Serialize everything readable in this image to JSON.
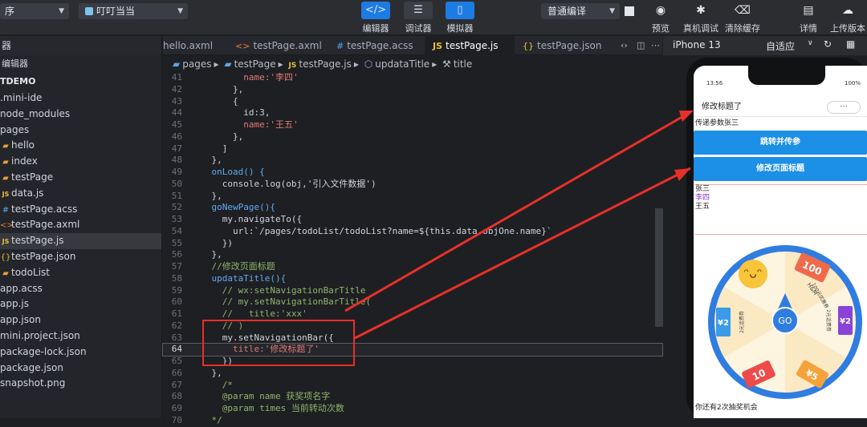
{
  "toolbar": {
    "mode_select": "序",
    "project_select": "叮叮当当",
    "buttons": [
      {
        "label": "编辑器",
        "icon": "code-icon",
        "active": true
      },
      {
        "label": "调试器",
        "icon": "sliders-icon",
        "active": false
      },
      {
        "label": "模拟器",
        "icon": "phone-icon",
        "active": false
      }
    ],
    "compile_select": "普通编译",
    "right_buttons": [
      {
        "label": "预览",
        "icon": "eye-icon"
      },
      {
        "label": "真机调试",
        "icon": "bug-icon"
      },
      {
        "label": "清除缓存",
        "icon": "broom-icon"
      },
      {
        "label": "详情",
        "icon": "document-icon"
      },
      {
        "label": "上传版本",
        "icon": "upload-icon"
      }
    ]
  },
  "sidebar": {
    "header": "器",
    "subheader": "编辑器",
    "project": "TDEMO",
    "items": [
      {
        "label": ".mini-ide",
        "icon": ""
      },
      {
        "label": "node_modules",
        "icon": ""
      },
      {
        "label": "pages",
        "icon": ""
      },
      {
        "label": "hello",
        "icon": "folder-icon"
      },
      {
        "label": "index",
        "icon": "folder-icon"
      },
      {
        "label": "testPage",
        "icon": "folder-icon"
      },
      {
        "label": "data.js",
        "icon": "js-icon"
      },
      {
        "label": "testPage.acss",
        "icon": "css-icon"
      },
      {
        "label": "testPage.axml",
        "icon": "xml-icon"
      },
      {
        "label": "testPage.js",
        "icon": "js-icon"
      },
      {
        "label": "testPage.json",
        "icon": "json-icon"
      },
      {
        "label": "todoList",
        "icon": "folder-icon"
      },
      {
        "label": "app.acss",
        "icon": ""
      },
      {
        "label": "app.js",
        "icon": ""
      },
      {
        "label": "app.json",
        "icon": ""
      },
      {
        "label": "mini.project.json",
        "icon": ""
      },
      {
        "label": "package-lock.json",
        "icon": ""
      },
      {
        "label": "package.json",
        "icon": ""
      },
      {
        "label": "snapshot.png",
        "icon": ""
      }
    ]
  },
  "tabs": [
    {
      "label": "hello.axml",
      "icon": "",
      "active": false
    },
    {
      "label": "testPage.axml",
      "icon": "<>",
      "active": false
    },
    {
      "label": "testPage.acss",
      "icon": "#",
      "active": false
    },
    {
      "label": "testPage.js",
      "icon": "JS",
      "active": true
    },
    {
      "label": "testPage.json",
      "icon": "{}",
      "active": false
    }
  ],
  "breadcrumb": [
    "pages",
    "testPage",
    "testPage.js",
    "updataTitle",
    "title"
  ],
  "code": {
    "lines": [
      {
        "n": "41",
        "text": "          name:'李四'"
      },
      {
        "n": "42",
        "text": "        },"
      },
      {
        "n": "43",
        "text": "        {"
      },
      {
        "n": "44",
        "text": "          id:3,"
      },
      {
        "n": "45",
        "text": "          name:'王五'"
      },
      {
        "n": "46",
        "text": "        },"
      },
      {
        "n": "47",
        "text": "      ]"
      },
      {
        "n": "48",
        "text": "    },"
      },
      {
        "n": "49",
        "text": "    onLoad() {"
      },
      {
        "n": "50",
        "text": "      console.log(obj,'引入文件数据')"
      },
      {
        "n": "51",
        "text": "    },"
      },
      {
        "n": "52",
        "text": "    goNewPage(){"
      },
      {
        "n": "53",
        "text": "      my.navigateTo({"
      },
      {
        "n": "54",
        "text": "        url:`/pages/todoList/todoList?name=${this.data.objOne.name}`"
      },
      {
        "n": "55",
        "text": "      })"
      },
      {
        "n": "56",
        "text": "    },"
      },
      {
        "n": "57",
        "text": "    //修改页面标题"
      },
      {
        "n": "58",
        "text": "    updataTitle(){"
      },
      {
        "n": "59",
        "text": "      // wx:setNavigationBarTitle"
      },
      {
        "n": "60",
        "text": "      // my.setNavigationBarTitle("
      },
      {
        "n": "61",
        "text": "      //   title:'xxx'"
      },
      {
        "n": "62",
        "text": "      // )"
      },
      {
        "n": "63",
        "text": "      my.setNavigationBar({"
      },
      {
        "n": "64",
        "text": "        title:'修改标题了'"
      },
      {
        "n": "65",
        "text": "      })"
      },
      {
        "n": "66",
        "text": "    },"
      },
      {
        "n": "67",
        "text": "      /*"
      },
      {
        "n": "68",
        "text": "      @param name 获奖项名字"
      },
      {
        "n": "69",
        "text": "      @param times 当前转动次数"
      },
      {
        "n": "70",
        "text": "    */"
      }
    ],
    "current_line": "64"
  },
  "simulator": {
    "device": "iPhone 13",
    "fit": "自适应",
    "status_time": "13:56",
    "status_battery": "100%",
    "nav_title": "修改标题了",
    "capsule": "···",
    "param_text": "传递参数张三",
    "btn_jump": "跳转并传参",
    "btn_title": "修改页面标题",
    "names": [
      "张三",
      "李四",
      "王五"
    ],
    "wheel_center": "GO",
    "wheel_prizes": [
      "100",
      "H&M",
      "100元优惠券",
      "¥2",
      "2元话费券",
      "10",
      "¥5",
      "¥2",
      "2元话费券"
    ],
    "chance_text": "你还有2次抽奖机会"
  }
}
